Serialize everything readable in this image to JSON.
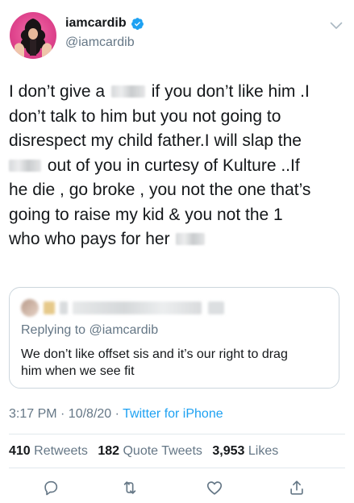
{
  "user": {
    "display_name": "iamcardib",
    "handle": "@iamcardib",
    "verified": true
  },
  "tweet": {
    "lines": [
      [
        "I don’t give a ",
        "if you don’t like him .I"
      ],
      [
        "don’t talk to him but you not going to"
      ],
      [
        "disrespect my child father.I will slap the"
      ],
      [
        "out of you in curtesy of Kulture ..If"
      ],
      [
        "he die , go broke , you not the one that’s"
      ],
      [
        "going to raise my kid & you not the 1"
      ],
      [
        "who who pays for her"
      ]
    ]
  },
  "quote": {
    "replying_prefix": "Replying to ",
    "replying_to": "@iamcardib",
    "text_lines": [
      "We don’t like offset sis and it’s our right to drag",
      "him when we see fit"
    ]
  },
  "meta": {
    "time": "3:17 PM · 10/8/20 · ",
    "source": "Twitter for iPhone"
  },
  "stats": {
    "retweets_count": "410",
    "retweets_label": "Retweets",
    "quote_count": "182",
    "quote_label": "Quote Tweets",
    "likes_count": "3,953",
    "likes_label": "Likes"
  },
  "colors": {
    "accent": "#1da1f2",
    "muted": "#657786",
    "text": "#14171a",
    "border": "#e1e8ed"
  },
  "icons": [
    "reply-icon",
    "retweet-icon",
    "like-icon",
    "share-icon",
    "verified-badge-icon",
    "chevron-down-icon"
  ]
}
